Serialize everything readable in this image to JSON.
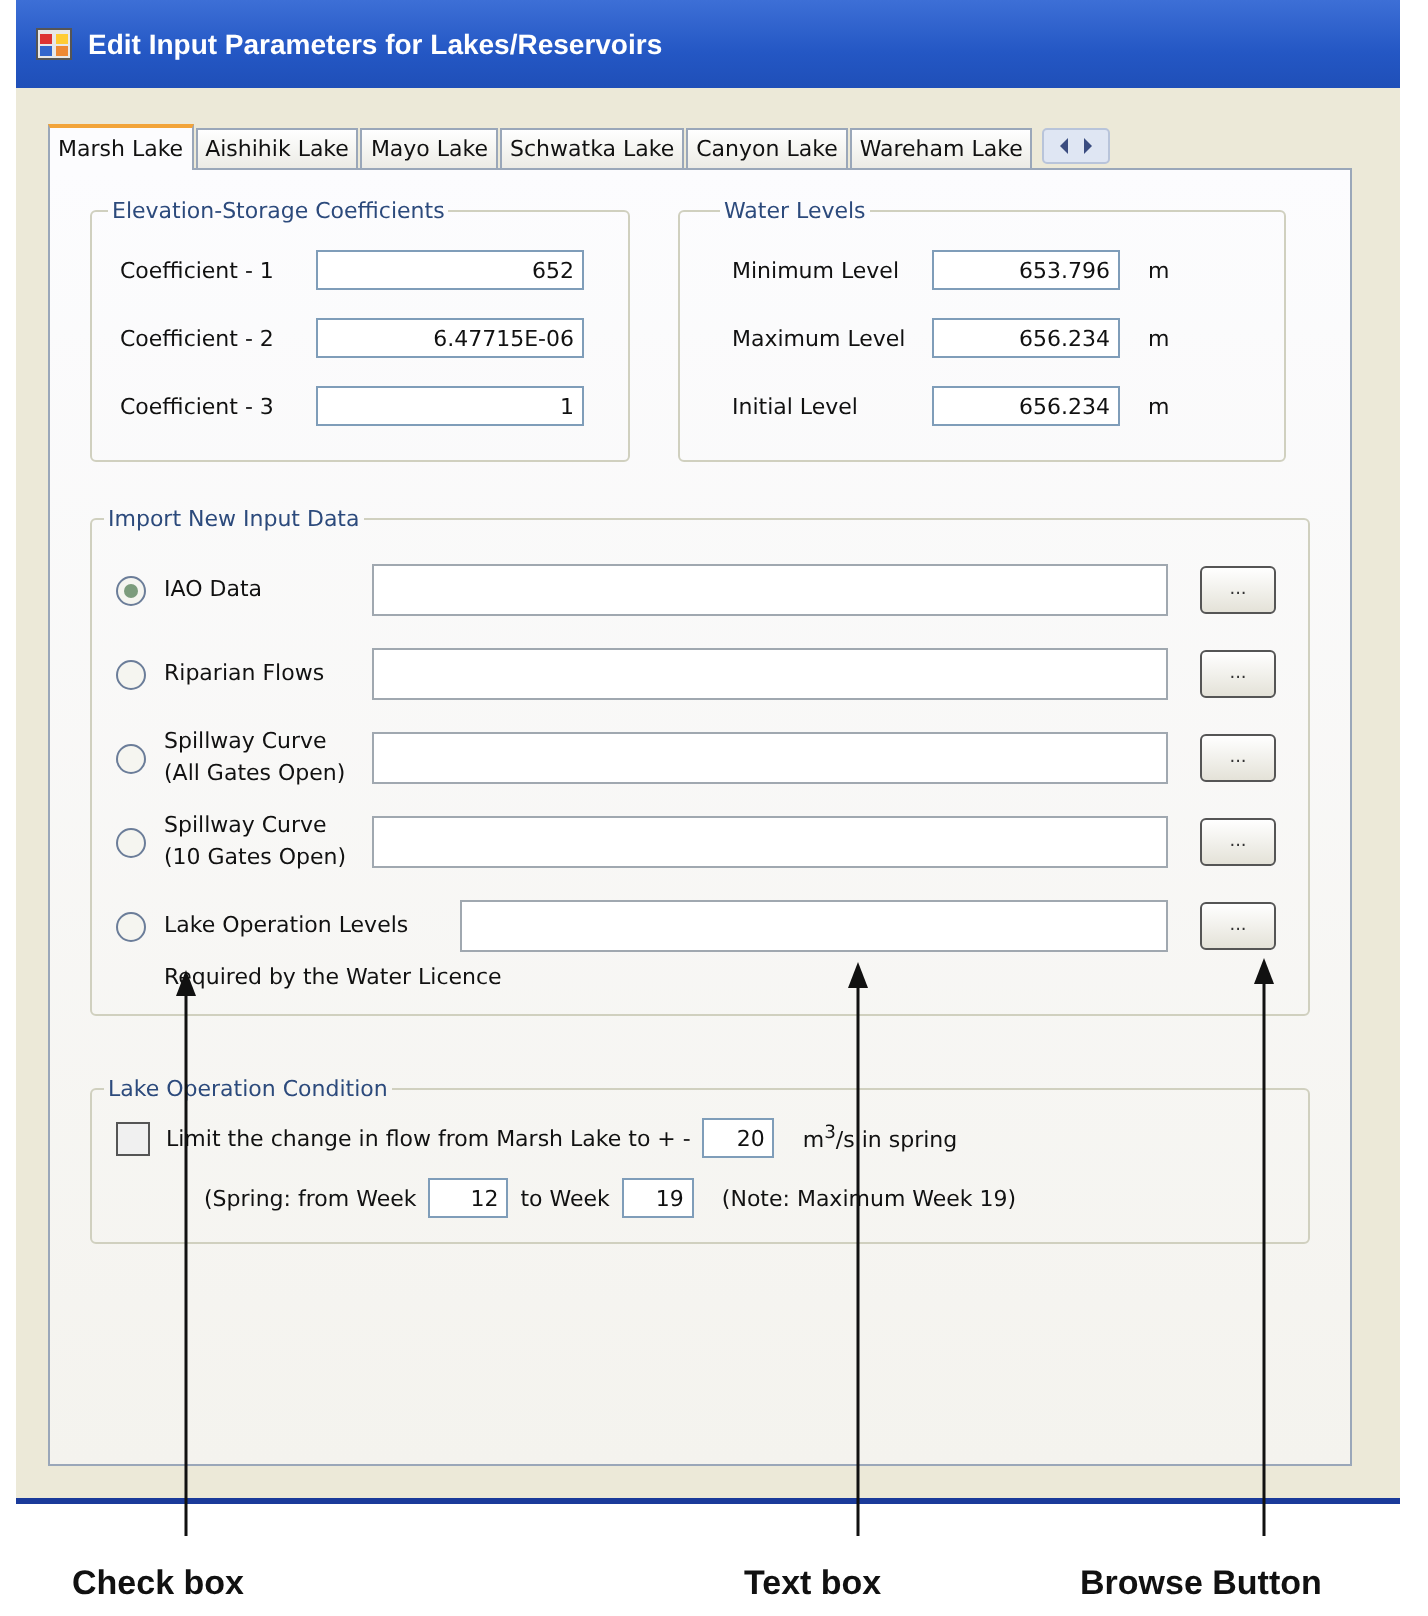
{
  "window": {
    "title": "Edit Input Parameters for Lakes/Reservoirs"
  },
  "tabs": [
    {
      "label": "Marsh Lake",
      "selected": true
    },
    {
      "label": "Aishihik Lake",
      "selected": false
    },
    {
      "label": "Mayo Lake",
      "selected": false
    },
    {
      "label": "Schwatka Lake",
      "selected": false
    },
    {
      "label": "Canyon Lake",
      "selected": false
    },
    {
      "label": "Wareham Lake",
      "selected": false
    }
  ],
  "elevation_storage": {
    "title": "Elevation-Storage Coefficients",
    "fields": [
      {
        "label": "Coefficient - 1",
        "value": "652"
      },
      {
        "label": "Coefficient - 2",
        "value": "6.47715E-06"
      },
      {
        "label": "Coefficient - 3",
        "value": "1"
      }
    ]
  },
  "water_levels": {
    "title": "Water Levels",
    "fields": [
      {
        "label": "Minimum Level",
        "value": "653.796",
        "unit": "m"
      },
      {
        "label": "Maximum Level",
        "value": "656.234",
        "unit": "m"
      },
      {
        "label": "Initial Level",
        "value": "656.234",
        "unit": "m"
      }
    ]
  },
  "import": {
    "title": "Import New Input Data",
    "rows": [
      {
        "label": "IAO Data",
        "selected": true,
        "browse": "..."
      },
      {
        "label": "Riparian Flows",
        "selected": false,
        "browse": "..."
      },
      {
        "label": "Spillway Curve\n(All Gates Open)",
        "selected": false,
        "browse": "..."
      },
      {
        "label": "Spillway Curve\n(10 Gates Open)",
        "selected": false,
        "browse": "..."
      },
      {
        "label": "Lake Operation Levels",
        "note": "Required by the Water Licence",
        "selected": false,
        "browse": "..."
      }
    ]
  },
  "condition": {
    "title": "Lake Operation Condition",
    "checked": false,
    "text_before": "Limit the change in flow from Marsh Lake to + -",
    "limit": "20",
    "text_after": "m$^{3}$/s in spring",
    "spring_from": "(Spring: from Week",
    "from_week": "12",
    "to_label": "to Week",
    "to_week": "19",
    "note": "(Note: Maximum Week 19)"
  },
  "annotations": [
    "Check box",
    "Text box",
    "Browse Button"
  ]
}
